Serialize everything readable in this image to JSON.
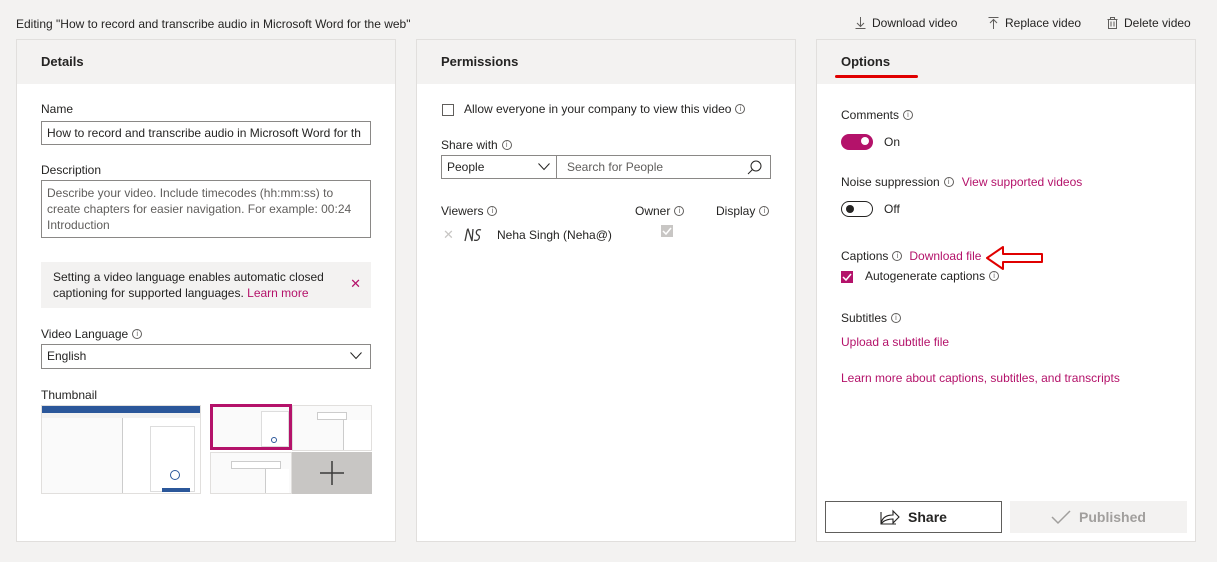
{
  "header": {
    "editing_title": "Editing \"How to record and transcribe audio in Microsoft Word for the web\"",
    "actions": [
      {
        "label": "Download video",
        "icon": "download-icon"
      },
      {
        "label": "Replace video",
        "icon": "upload-icon"
      },
      {
        "label": "Delete video",
        "icon": "trash-icon"
      }
    ]
  },
  "details": {
    "title": "Details",
    "name_label": "Name",
    "name_value": "How to record and transcribe audio in Microsoft Word for th",
    "description_label": "Description",
    "description_placeholder": "Describe your video. Include timecodes (hh:mm:ss) to create chapters for easier navigation. For example: 00:24 Introduction",
    "notice_text": "Setting a video language enables automatic closed captioning for supported languages.",
    "notice_link": "Learn more",
    "language_label": "Video Language",
    "language_value": "English",
    "thumbnail_label": "Thumbnail"
  },
  "permissions": {
    "title": "Permissions",
    "allow_everyone_label": "Allow everyone in your company to view this video",
    "share_with_label": "Share with",
    "share_type_value": "People",
    "search_placeholder": "Search for People",
    "columns": {
      "viewers": "Viewers",
      "owner": "Owner",
      "display": "Display"
    },
    "viewers": [
      {
        "name": "Neha Singh (Neha@)",
        "owner": true
      }
    ]
  },
  "options": {
    "title": "Options",
    "comments_label": "Comments",
    "comments_state": "On",
    "noise_label": "Noise suppression",
    "noise_link": "View supported videos",
    "noise_state": "Off",
    "captions_label": "Captions",
    "captions_link": "Download file",
    "autogenerate_label": "Autogenerate captions",
    "subtitles_label": "Subtitles",
    "upload_subtitle_link": "Upload a subtitle file",
    "learn_more_link": "Learn more about captions, subtitles, and transcripts",
    "share_button": "Share",
    "published_button": "Published"
  },
  "colors": {
    "accent": "#b4126a",
    "annotation_red": "#e00000",
    "panel_bg": "#ffffff",
    "page_bg": "#f3f2f1"
  }
}
